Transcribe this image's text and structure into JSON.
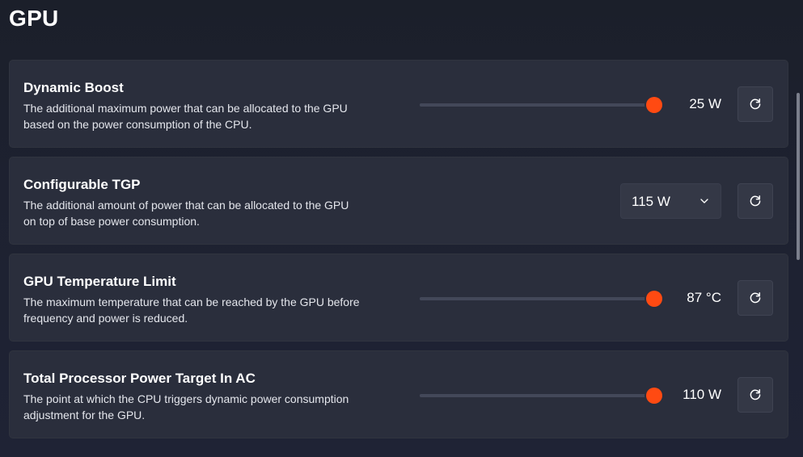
{
  "page": {
    "title": "GPU"
  },
  "cards": [
    {
      "title": "Dynamic Boost",
      "desc_line1": "The additional maximum power that can be allocated to the GPU",
      "desc_line2": "based on the power consumption of the CPU.",
      "control": "slider",
      "slider_level_percent": 96,
      "value": "25 W",
      "reset_icon": "refresh-icon"
    },
    {
      "title": "Configurable TGP",
      "desc_line1": "The additional amount of power that can be allocated to the GPU",
      "desc_line2": "on top of base power consumption.",
      "control": "dropdown",
      "value": "115 W",
      "dropdown_icon": "chevron-down-icon",
      "reset_icon": "refresh-icon"
    },
    {
      "title": "GPU Temperature Limit",
      "desc_line1": "The maximum temperature that can be reached by the GPU before",
      "desc_line2": "frequency and power is reduced.",
      "control": "slider",
      "slider_level_percent": 96,
      "value": "87 °C",
      "reset_icon": "refresh-icon"
    },
    {
      "title": "Total Processor Power Target In AC",
      "desc_line1": "The point at which the CPU triggers dynamic power consumption",
      "desc_line2": "adjustment for the GPU.",
      "control": "slider",
      "slider_level_percent": 96,
      "value": "110 W",
      "reset_icon": "refresh-icon"
    }
  ],
  "colors": {
    "accent": "#ff4a12",
    "card_background": "#2a2e3c",
    "page_background": "#1d2130"
  }
}
